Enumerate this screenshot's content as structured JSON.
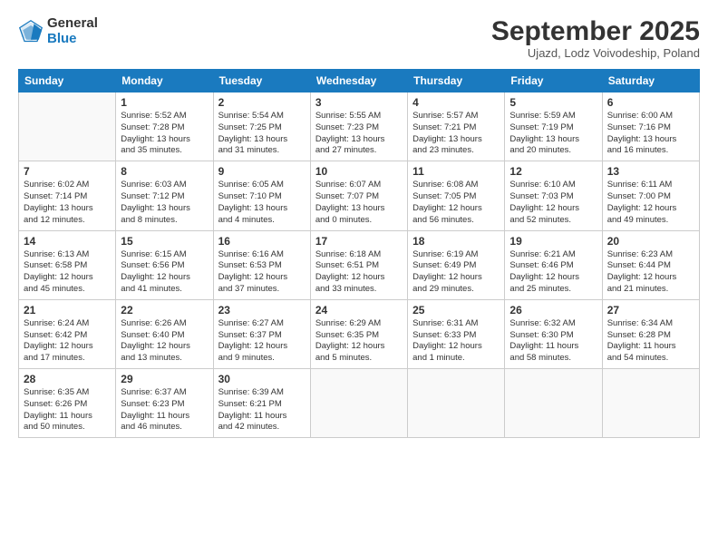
{
  "logo": {
    "general": "General",
    "blue": "Blue"
  },
  "title": "September 2025",
  "subtitle": "Ujazd, Lodz Voivodeship, Poland",
  "headers": [
    "Sunday",
    "Monday",
    "Tuesday",
    "Wednesday",
    "Thursday",
    "Friday",
    "Saturday"
  ],
  "weeks": [
    [
      {
        "date": "",
        "text": ""
      },
      {
        "date": "1",
        "text": "Sunrise: 5:52 AM\nSunset: 7:28 PM\nDaylight: 13 hours\nand 35 minutes."
      },
      {
        "date": "2",
        "text": "Sunrise: 5:54 AM\nSunset: 7:25 PM\nDaylight: 13 hours\nand 31 minutes."
      },
      {
        "date": "3",
        "text": "Sunrise: 5:55 AM\nSunset: 7:23 PM\nDaylight: 13 hours\nand 27 minutes."
      },
      {
        "date": "4",
        "text": "Sunrise: 5:57 AM\nSunset: 7:21 PM\nDaylight: 13 hours\nand 23 minutes."
      },
      {
        "date": "5",
        "text": "Sunrise: 5:59 AM\nSunset: 7:19 PM\nDaylight: 13 hours\nand 20 minutes."
      },
      {
        "date": "6",
        "text": "Sunrise: 6:00 AM\nSunset: 7:16 PM\nDaylight: 13 hours\nand 16 minutes."
      }
    ],
    [
      {
        "date": "7",
        "text": "Sunrise: 6:02 AM\nSunset: 7:14 PM\nDaylight: 13 hours\nand 12 minutes."
      },
      {
        "date": "8",
        "text": "Sunrise: 6:03 AM\nSunset: 7:12 PM\nDaylight: 13 hours\nand 8 minutes."
      },
      {
        "date": "9",
        "text": "Sunrise: 6:05 AM\nSunset: 7:10 PM\nDaylight: 13 hours\nand 4 minutes."
      },
      {
        "date": "10",
        "text": "Sunrise: 6:07 AM\nSunset: 7:07 PM\nDaylight: 13 hours\nand 0 minutes."
      },
      {
        "date": "11",
        "text": "Sunrise: 6:08 AM\nSunset: 7:05 PM\nDaylight: 12 hours\nand 56 minutes."
      },
      {
        "date": "12",
        "text": "Sunrise: 6:10 AM\nSunset: 7:03 PM\nDaylight: 12 hours\nand 52 minutes."
      },
      {
        "date": "13",
        "text": "Sunrise: 6:11 AM\nSunset: 7:00 PM\nDaylight: 12 hours\nand 49 minutes."
      }
    ],
    [
      {
        "date": "14",
        "text": "Sunrise: 6:13 AM\nSunset: 6:58 PM\nDaylight: 12 hours\nand 45 minutes."
      },
      {
        "date": "15",
        "text": "Sunrise: 6:15 AM\nSunset: 6:56 PM\nDaylight: 12 hours\nand 41 minutes."
      },
      {
        "date": "16",
        "text": "Sunrise: 6:16 AM\nSunset: 6:53 PM\nDaylight: 12 hours\nand 37 minutes."
      },
      {
        "date": "17",
        "text": "Sunrise: 6:18 AM\nSunset: 6:51 PM\nDaylight: 12 hours\nand 33 minutes."
      },
      {
        "date": "18",
        "text": "Sunrise: 6:19 AM\nSunset: 6:49 PM\nDaylight: 12 hours\nand 29 minutes."
      },
      {
        "date": "19",
        "text": "Sunrise: 6:21 AM\nSunset: 6:46 PM\nDaylight: 12 hours\nand 25 minutes."
      },
      {
        "date": "20",
        "text": "Sunrise: 6:23 AM\nSunset: 6:44 PM\nDaylight: 12 hours\nand 21 minutes."
      }
    ],
    [
      {
        "date": "21",
        "text": "Sunrise: 6:24 AM\nSunset: 6:42 PM\nDaylight: 12 hours\nand 17 minutes."
      },
      {
        "date": "22",
        "text": "Sunrise: 6:26 AM\nSunset: 6:40 PM\nDaylight: 12 hours\nand 13 minutes."
      },
      {
        "date": "23",
        "text": "Sunrise: 6:27 AM\nSunset: 6:37 PM\nDaylight: 12 hours\nand 9 minutes."
      },
      {
        "date": "24",
        "text": "Sunrise: 6:29 AM\nSunset: 6:35 PM\nDaylight: 12 hours\nand 5 minutes."
      },
      {
        "date": "25",
        "text": "Sunrise: 6:31 AM\nSunset: 6:33 PM\nDaylight: 12 hours\nand 1 minute."
      },
      {
        "date": "26",
        "text": "Sunrise: 6:32 AM\nSunset: 6:30 PM\nDaylight: 11 hours\nand 58 minutes."
      },
      {
        "date": "27",
        "text": "Sunrise: 6:34 AM\nSunset: 6:28 PM\nDaylight: 11 hours\nand 54 minutes."
      }
    ],
    [
      {
        "date": "28",
        "text": "Sunrise: 6:35 AM\nSunset: 6:26 PM\nDaylight: 11 hours\nand 50 minutes."
      },
      {
        "date": "29",
        "text": "Sunrise: 6:37 AM\nSunset: 6:23 PM\nDaylight: 11 hours\nand 46 minutes."
      },
      {
        "date": "30",
        "text": "Sunrise: 6:39 AM\nSunset: 6:21 PM\nDaylight: 11 hours\nand 42 minutes."
      },
      {
        "date": "",
        "text": ""
      },
      {
        "date": "",
        "text": ""
      },
      {
        "date": "",
        "text": ""
      },
      {
        "date": "",
        "text": ""
      }
    ]
  ]
}
